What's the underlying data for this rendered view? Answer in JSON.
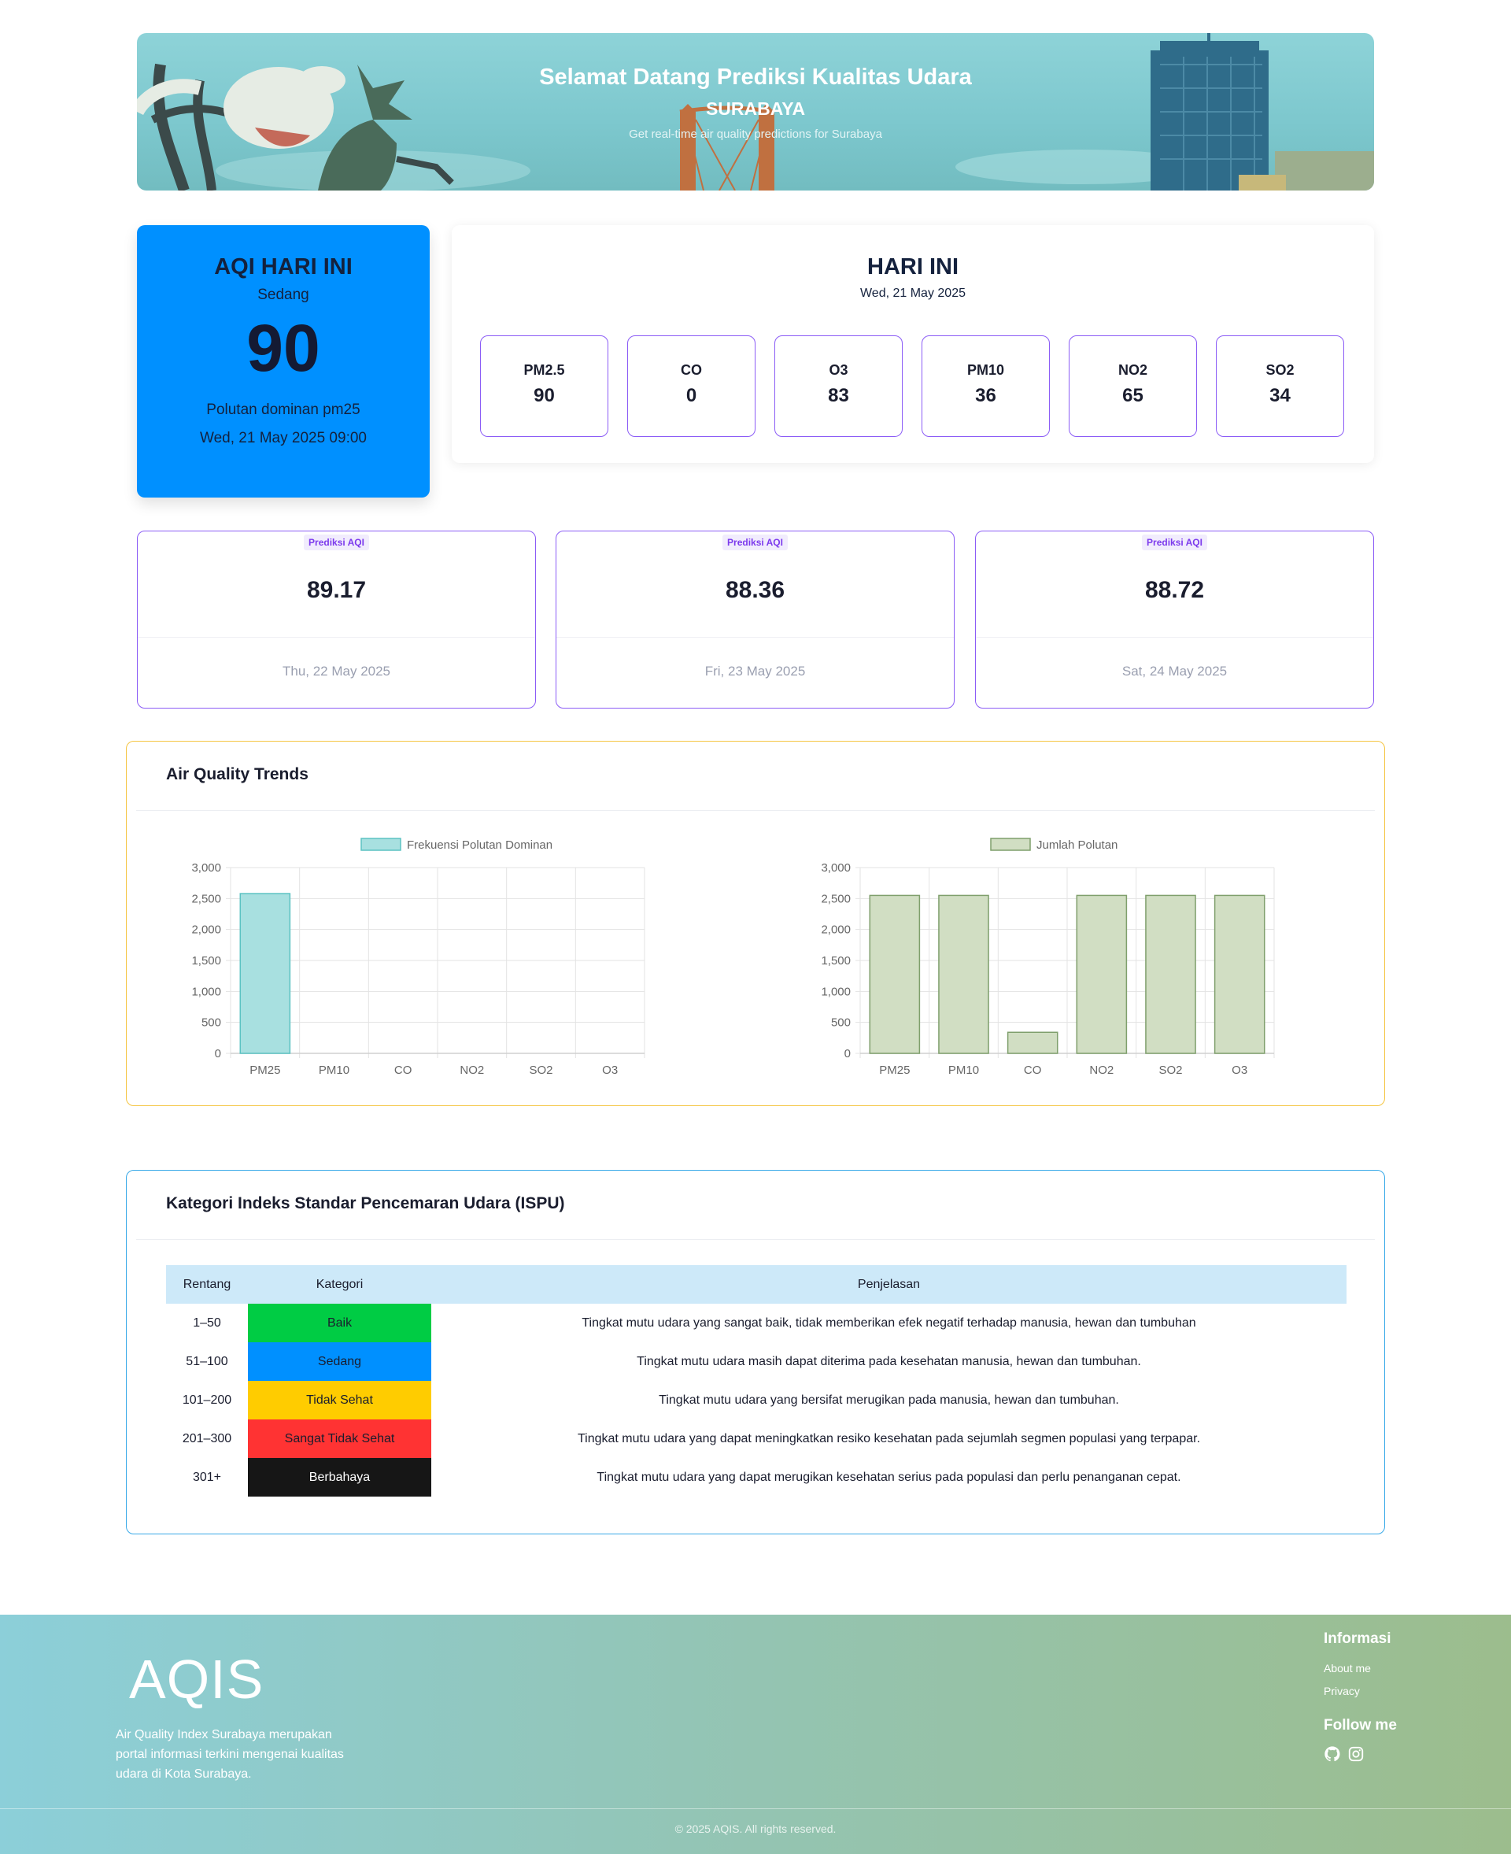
{
  "hero": {
    "title": "Selamat Datang Prediksi Kualitas Udara",
    "city": "SURABAYA",
    "subtitle": "Get real-time air quality predictions for Surabaya"
  },
  "aqi_today": {
    "title": "AQI HARI INI",
    "category": "Sedang",
    "value": "90",
    "dominant": "Polutan dominan pm25",
    "timestamp": "Wed, 21 May 2025 09:00",
    "color": "#0090ff"
  },
  "today": {
    "title": "HARI INI",
    "date": "Wed, 21 May 2025",
    "pollutants": [
      {
        "name": "PM2.5",
        "value": "90"
      },
      {
        "name": "CO",
        "value": "0"
      },
      {
        "name": "O3",
        "value": "83"
      },
      {
        "name": "PM10",
        "value": "36"
      },
      {
        "name": "NO2",
        "value": "65"
      },
      {
        "name": "SO2",
        "value": "34"
      }
    ]
  },
  "predictions": [
    {
      "badge": "Prediksi AQI",
      "value": "89.17",
      "date": "Thu, 22 May 2025"
    },
    {
      "badge": "Prediksi AQI",
      "value": "88.36",
      "date": "Fri, 23 May 2025"
    },
    {
      "badge": "Prediksi AQI",
      "value": "88.72",
      "date": "Sat, 24 May 2025"
    }
  ],
  "trends": {
    "title": "Air Quality Trends"
  },
  "chart_data": [
    {
      "type": "bar",
      "categories": [
        "PM25",
        "PM10",
        "CO",
        "NO2",
        "SO2",
        "O3"
      ],
      "series": [
        {
          "name": "Frekuensi Polutan Dominan",
          "values": [
            2580,
            0,
            0,
            0,
            0,
            0
          ]
        }
      ],
      "yticks": [
        "0",
        "500",
        "1,000",
        "1,500",
        "2,000",
        "2,500",
        "3,000"
      ],
      "ylim": [
        0,
        3000
      ],
      "grid": true,
      "legend": "top",
      "fill": "#a8e0e0",
      "stroke": "#5cc2c2"
    },
    {
      "type": "bar",
      "categories": [
        "PM25",
        "PM10",
        "CO",
        "NO2",
        "SO2",
        "O3"
      ],
      "series": [
        {
          "name": "Jumlah Polutan",
          "values": [
            2550,
            2550,
            340,
            2550,
            2550,
            2550
          ]
        }
      ],
      "yticks": [
        "0",
        "500",
        "1,000",
        "1,500",
        "2,000",
        "2,500",
        "3,000"
      ],
      "ylim": [
        0,
        3000
      ],
      "grid": true,
      "legend": "top",
      "fill": "#d1dec3",
      "stroke": "#7f9f6c"
    }
  ],
  "ispu": {
    "title": "Kategori Indeks Standar Pencemaran Udara (ISPU)",
    "headers": [
      "Rentang",
      "Kategori",
      "Penjelasan"
    ],
    "rows": [
      {
        "range": "1–50",
        "category": "Baik",
        "bg": "#00cc44",
        "fg": "#1a1d2e",
        "desc": "Tingkat mutu udara yang sangat baik, tidak memberikan efek negatif terhadap manusia, hewan dan tumbuhan"
      },
      {
        "range": "51–100",
        "category": "Sedang",
        "bg": "#0090ff",
        "fg": "#1a1d2e",
        "desc": "Tingkat mutu udara masih dapat diterima pada kesehatan manusia, hewan dan tumbuhan."
      },
      {
        "range": "101–200",
        "category": "Tidak Sehat",
        "bg": "#ffcc00",
        "fg": "#1a1d2e",
        "desc": "Tingkat mutu udara yang bersifat merugikan pada manusia, hewan dan tumbuhan."
      },
      {
        "range": "201–300",
        "category": "Sangat Tidak Sehat",
        "bg": "#ff3333",
        "fg": "#1a1d2e",
        "desc": "Tingkat mutu udara yang dapat meningkatkan resiko kesehatan pada sejumlah segmen populasi yang terpapar."
      },
      {
        "range": "301+",
        "category": "Berbahaya",
        "bg": "#161616",
        "fg": "#ffffff",
        "desc": "Tingkat mutu udara yang dapat merugikan kesehatan serius pada populasi dan perlu penanganan cepat."
      }
    ]
  },
  "footer": {
    "logo": "AQIS",
    "about": "Air Quality Index Surabaya merupakan portal informasi terkini mengenai kualitas udara di Kota Surabaya.",
    "info_title": "Informasi",
    "links": [
      "About me",
      "Privacy"
    ],
    "follow_title": "Follow me",
    "social_icons": [
      "github-icon",
      "instagram-icon"
    ],
    "copyright": "© 2025 AQIS. All rights reserved."
  }
}
